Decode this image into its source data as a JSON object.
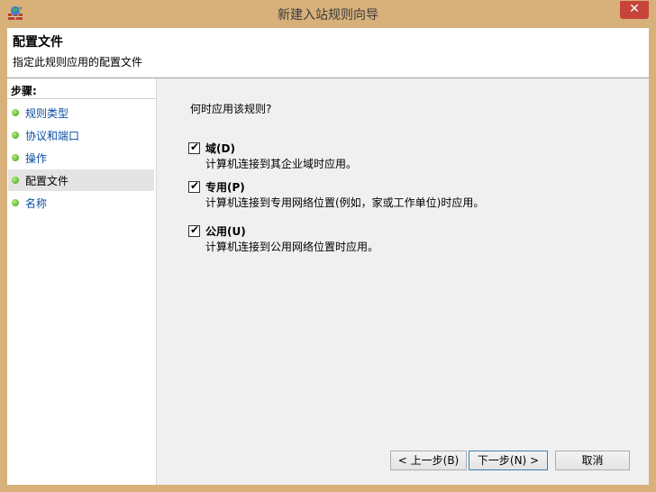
{
  "window": {
    "title": "新建入站规则向导",
    "close_glyph": "✕",
    "app_icon": "firewall-wizard-icon"
  },
  "header": {
    "title": "配置文件",
    "subtitle": "指定此规则应用的配置文件"
  },
  "steps": {
    "heading": "步骤:",
    "items": [
      {
        "label": "规则类型",
        "active": false
      },
      {
        "label": "协议和端口",
        "active": false
      },
      {
        "label": "操作",
        "active": false
      },
      {
        "label": "配置文件",
        "active": true
      },
      {
        "label": "名称",
        "active": false
      }
    ]
  },
  "main": {
    "question": "何时应用该规则?",
    "options": [
      {
        "label": "域(D)",
        "description": "计算机连接到其企业域时应用。",
        "checked": true
      },
      {
        "label": "专用(P)",
        "description": "计算机连接到专用网络位置(例如，家或工作单位)时应用。",
        "checked": true
      },
      {
        "label": "公用(U)",
        "description": "计算机连接到公用网络位置时应用。",
        "checked": true
      }
    ]
  },
  "buttons": {
    "back": "< 上一步(B)",
    "next": "下一步(N) >",
    "cancel": "取消"
  },
  "colors": {
    "frame": "#d7b07a",
    "close": "#c7443b",
    "link": "#0b4ea2"
  }
}
